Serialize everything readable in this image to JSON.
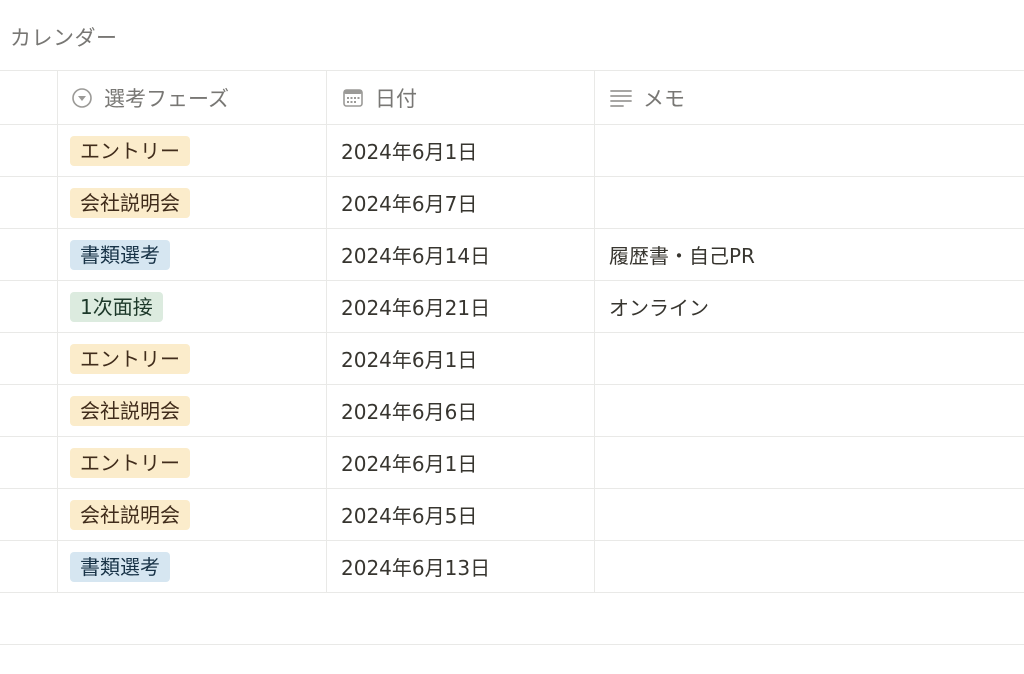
{
  "view": {
    "title": "カレンダー"
  },
  "columns": {
    "phase": {
      "label": "選考フェーズ",
      "icon": "select-icon"
    },
    "date": {
      "label": "日付",
      "icon": "calendar-icon"
    },
    "memo": {
      "label": "メモ",
      "icon": "text-lines-icon"
    }
  },
  "tag_colors": {
    "entry": "#fbeccb",
    "briefing": "#fbeccb",
    "screening": "#d6e6f1",
    "interview": "#dcebdf"
  },
  "rows": [
    {
      "phase": "エントリー",
      "phase_kind": "entry",
      "date": "2024年6月1日",
      "memo": ""
    },
    {
      "phase": "会社説明会",
      "phase_kind": "briefing",
      "date": "2024年6月7日",
      "memo": ""
    },
    {
      "phase": "書類選考",
      "phase_kind": "screening",
      "date": "2024年6月14日",
      "memo": "履歴書・自己PR"
    },
    {
      "phase": "1次面接",
      "phase_kind": "interview",
      "date": "2024年6月21日",
      "memo": "オンライン"
    },
    {
      "phase": "エントリー",
      "phase_kind": "entry",
      "date": "2024年6月1日",
      "memo": ""
    },
    {
      "phase": "会社説明会",
      "phase_kind": "briefing",
      "date": "2024年6月6日",
      "memo": ""
    },
    {
      "phase": "エントリー",
      "phase_kind": "entry",
      "date": "2024年6月1日",
      "memo": ""
    },
    {
      "phase": "会社説明会",
      "phase_kind": "briefing",
      "date": "2024年6月5日",
      "memo": ""
    },
    {
      "phase": "書類選考",
      "phase_kind": "screening",
      "date": "2024年6月13日",
      "memo": ""
    }
  ]
}
